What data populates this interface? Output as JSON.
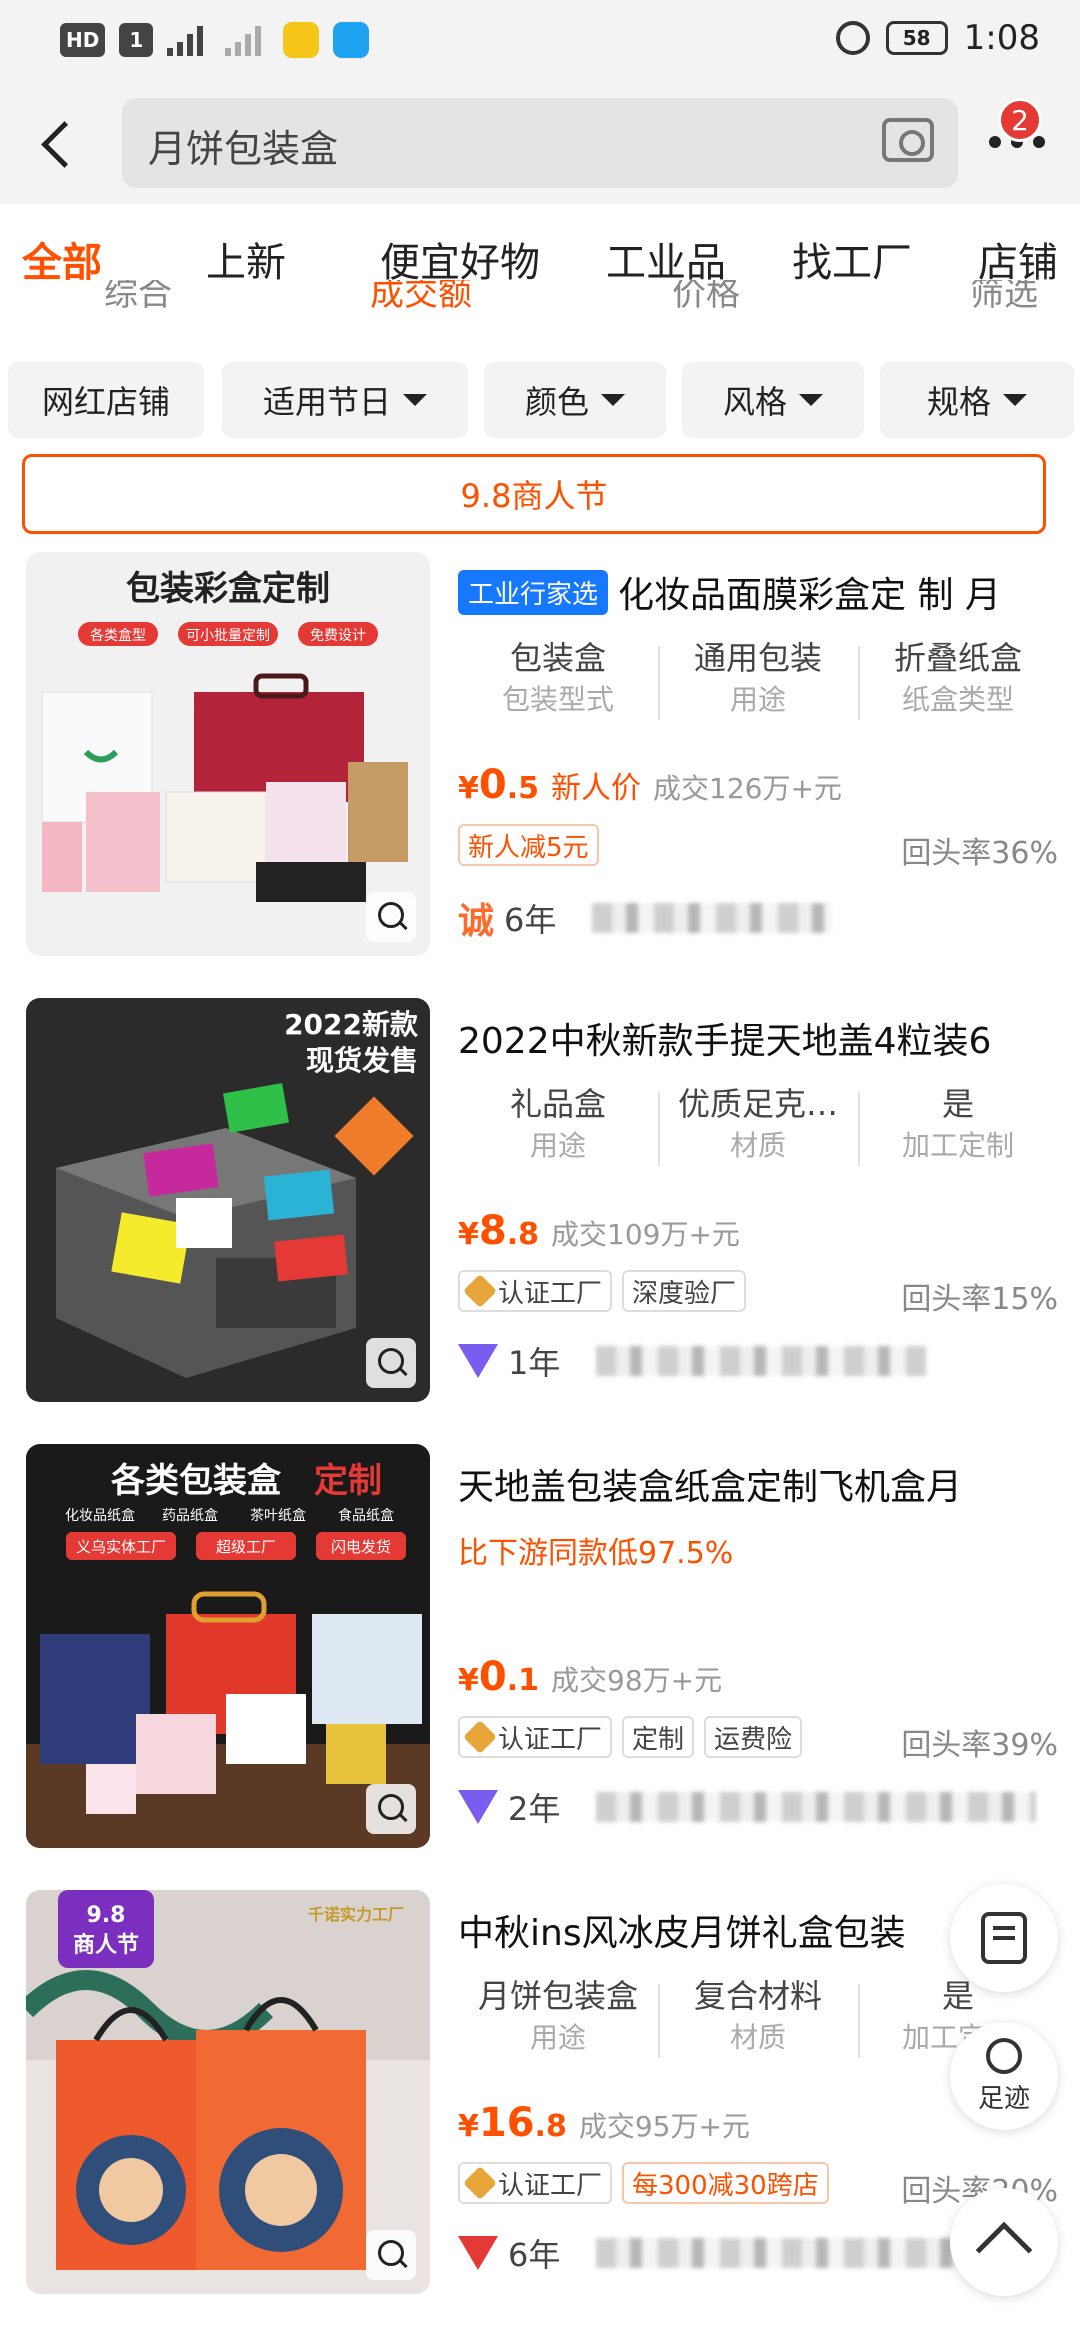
{
  "status_bar": {
    "left_chips": [
      "HD",
      "1"
    ],
    "network": "5G",
    "battery": "58",
    "time": "1:08"
  },
  "header": {
    "search_text": "月饼包装盒",
    "badge_count": "2"
  },
  "tabs": [
    {
      "label": "全部",
      "active": true
    },
    {
      "label": "上新"
    },
    {
      "label": "便宜好物"
    },
    {
      "label": "工业品"
    },
    {
      "label": "找工厂"
    },
    {
      "label": "店铺"
    }
  ],
  "sort": [
    "综合",
    "成交额",
    "价格",
    "筛选"
  ],
  "filters": [
    "网红店铺",
    "适用节日",
    "颜色",
    "风格",
    "规格"
  ],
  "promo": "9.8商人节",
  "products": [
    {
      "image_text": [
        "包装彩盒定制",
        "各类盒型",
        "可小批量定制",
        "免费设计"
      ],
      "industry_tag": "工业行家选",
      "title": "化妆品面膜彩盒定 制 月",
      "attrs": [
        {
          "value": "包装盒",
          "key": "包装型式"
        },
        {
          "value": "通用包装",
          "key": "用途"
        },
        {
          "value": "折叠纸盒",
          "key": "纸盒类型"
        }
      ],
      "price_yen": "¥",
      "price_int": "0",
      "price_dec": ".5",
      "price_note": "新人价",
      "deal": "成交126万+元",
      "tags": [
        "新人减5元"
      ],
      "repeat": "回头率36%",
      "shop_mark": "诚",
      "years": "6年"
    },
    {
      "image_text": [
        "2022新款",
        "现货发售"
      ],
      "title": "2022中秋新款手提天地盖4粒装6",
      "attrs": [
        {
          "value": "礼品盒",
          "key": "用途"
        },
        {
          "value": "优质足克…",
          "key": "材质"
        },
        {
          "value": "是",
          "key": "加工定制"
        }
      ],
      "price_yen": "¥",
      "price_int": "8",
      "price_dec": ".8",
      "deal": "成交109万+元",
      "tags": [
        "认证工厂",
        "深度验厂"
      ],
      "repeat": "回头率15%",
      "years": "1年"
    },
    {
      "image_text": [
        "各类包装盒",
        "定制",
        "化妆品纸盒",
        "药品纸盒",
        "茶叶纸盒",
        "食品纸盒",
        "义乌实体工厂",
        "超级工厂",
        "闪电发货"
      ],
      "title": "天地盖包装盒纸盒定制飞机盒月",
      "subline": "比下游同款低97.5%",
      "price_yen": "¥",
      "price_int": "0",
      "price_dec": ".1",
      "deal": "成交98万+元",
      "tags": [
        "认证工厂",
        "定制",
        "运费险"
      ],
      "repeat": "回头率39%",
      "years": "2年"
    },
    {
      "image_text": [
        "9.8",
        "商人节",
        "千诺实力工厂"
      ],
      "title": "中秋ins风冰皮月饼礼盒包装",
      "attrs": [
        {
          "value": "月饼包装盒",
          "key": "用途"
        },
        {
          "value": "复合材料",
          "key": "材质"
        },
        {
          "value": "是",
          "key": "加工定制"
        }
      ],
      "price_yen": "¥",
      "price_int": "16",
      "price_dec": ".8",
      "deal": "成交95万+元",
      "tags": [
        "认证工厂",
        "每300减30跨店"
      ],
      "repeat": "回头率20%",
      "years": "6年"
    }
  ],
  "float": {
    "footprint_label": "足迹"
  }
}
